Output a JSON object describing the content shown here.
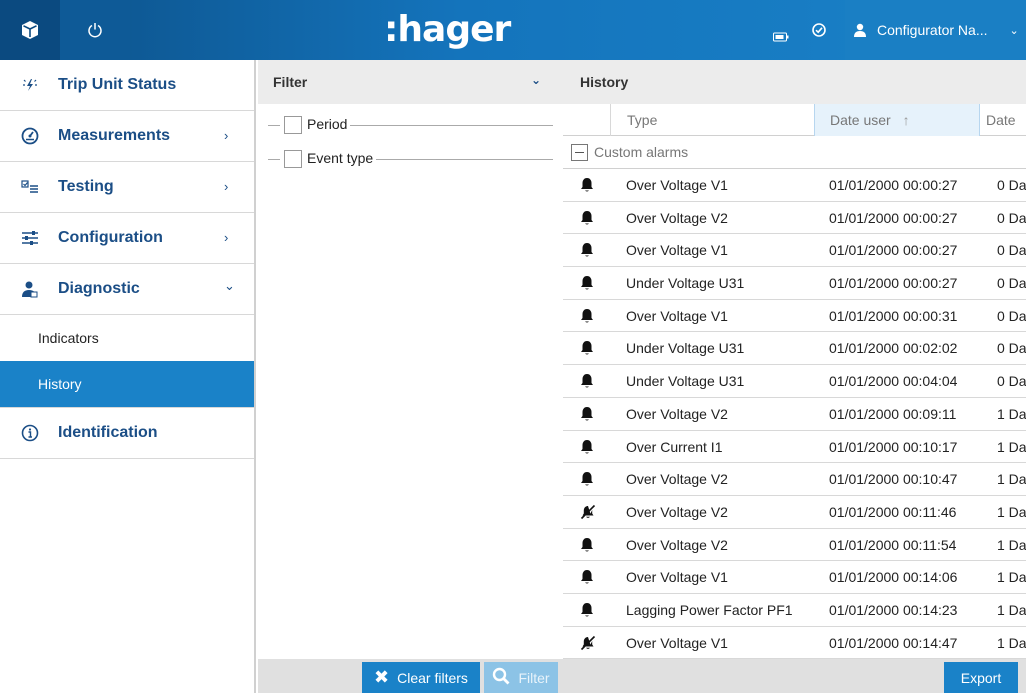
{
  "topbar": {
    "brand": ":hager",
    "user_name": "Configurator Na..."
  },
  "sidebar": {
    "items": [
      {
        "label": "Trip Unit Status"
      },
      {
        "label": "Measurements"
      },
      {
        "label": "Testing"
      },
      {
        "label": "Configuration"
      },
      {
        "label": "Diagnostic"
      },
      {
        "label": "Identification"
      }
    ],
    "sub_items": [
      {
        "label": "Indicators"
      },
      {
        "label": "History"
      }
    ]
  },
  "filter": {
    "title": "Filter",
    "options": [
      {
        "label": "Period"
      },
      {
        "label": "Event type"
      }
    ],
    "clear_label": "Clear filters",
    "filter_label": "Filter"
  },
  "history": {
    "title": "History",
    "columns": {
      "type": "Type",
      "date_user": "Date user",
      "date2": "Date"
    },
    "group_label": "Custom alarms",
    "rows": [
      {
        "icon": "bell-icon",
        "type": "Over Voltage V1",
        "date": "01/01/2000 00:00:27",
        "duration": "0 Da"
      },
      {
        "icon": "bell-icon",
        "type": "Over Voltage V2",
        "date": "01/01/2000 00:00:27",
        "duration": "0 Da"
      },
      {
        "icon": "bell-icon",
        "type": "Over Voltage V1",
        "date": "01/01/2000 00:00:27",
        "duration": "0 Da"
      },
      {
        "icon": "bell-icon",
        "type": "Under Voltage U31",
        "date": "01/01/2000 00:00:27",
        "duration": "0 Da"
      },
      {
        "icon": "bell-icon",
        "type": "Over Voltage V1",
        "date": "01/01/2000 00:00:31",
        "duration": "0 Da"
      },
      {
        "icon": "bell-icon",
        "type": "Under Voltage U31",
        "date": "01/01/2000 00:02:02",
        "duration": "0 Da"
      },
      {
        "icon": "bell-icon",
        "type": "Under Voltage U31",
        "date": "01/01/2000 00:04:04",
        "duration": "0 Da"
      },
      {
        "icon": "bell-icon",
        "type": "Over Voltage V2",
        "date": "01/01/2000 00:09:11",
        "duration": "1 Da"
      },
      {
        "icon": "bell-icon",
        "type": "Over Current I1",
        "date": "01/01/2000 00:10:17",
        "duration": "1 Da"
      },
      {
        "icon": "bell-icon",
        "type": "Over Voltage V2",
        "date": "01/01/2000 00:10:47",
        "duration": "1 Da"
      },
      {
        "icon": "bell-off-icon",
        "type": "Over Voltage V2",
        "date": "01/01/2000 00:11:46",
        "duration": "1 Da"
      },
      {
        "icon": "bell-icon",
        "type": "Over Voltage V2",
        "date": "01/01/2000 00:11:54",
        "duration": "1 Da"
      },
      {
        "icon": "bell-icon",
        "type": "Over Voltage V1",
        "date": "01/01/2000 00:14:06",
        "duration": "1 Da"
      },
      {
        "icon": "bell-icon",
        "type": "Lagging Power Factor PF1",
        "date": "01/01/2000 00:14:23",
        "duration": "1 Da"
      },
      {
        "icon": "bell-off-icon",
        "type": "Over Voltage V1",
        "date": "01/01/2000 00:14:47",
        "duration": "1 Da"
      }
    ],
    "export_label": "Export"
  },
  "colors": {
    "brand_blue": "#1a82c8",
    "dark_blue": "#0c4f86",
    "nav_text": "#1b4e86"
  }
}
